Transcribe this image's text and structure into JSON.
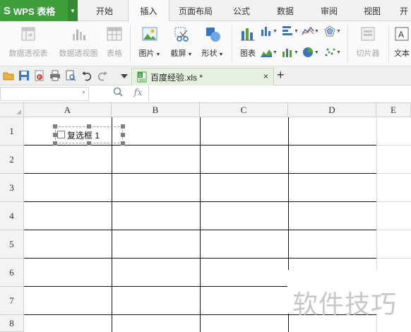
{
  "app": {
    "logo_glyph": "S",
    "name": "WPS 表格",
    "accent": "#3f9f3c"
  },
  "menu": {
    "tabs": [
      {
        "label": "开始"
      },
      {
        "label": "插入"
      },
      {
        "label": "页面布局"
      },
      {
        "label": "公式"
      },
      {
        "label": "数据"
      },
      {
        "label": "审阅"
      },
      {
        "label": "视图"
      },
      {
        "label": "开"
      }
    ],
    "active": "插入"
  },
  "ribbon": {
    "pivot_table": "数据透视表",
    "pivot_chart": "数据透视图",
    "table": "表格",
    "picture": "图片",
    "screenshot": "截屏",
    "shapes": "形状",
    "chart": "图表",
    "slicer": "切片器",
    "textbox": "文本"
  },
  "doc": {
    "tab_title": "百度经验.xls *",
    "close_glyph": "×",
    "new_tab_glyph": "+"
  },
  "formula_bar": {
    "cell_ref": "",
    "formula": "",
    "fx_label": "fx"
  },
  "sheet": {
    "columns": [
      "A",
      "B",
      "C",
      "D",
      "E"
    ],
    "rows": [
      "1",
      "2",
      "3",
      "4",
      "5",
      "6",
      "7",
      "8"
    ],
    "checkbox_label": "复选框 1",
    "checkbox_checked": false
  },
  "watermark": "软件技巧"
}
